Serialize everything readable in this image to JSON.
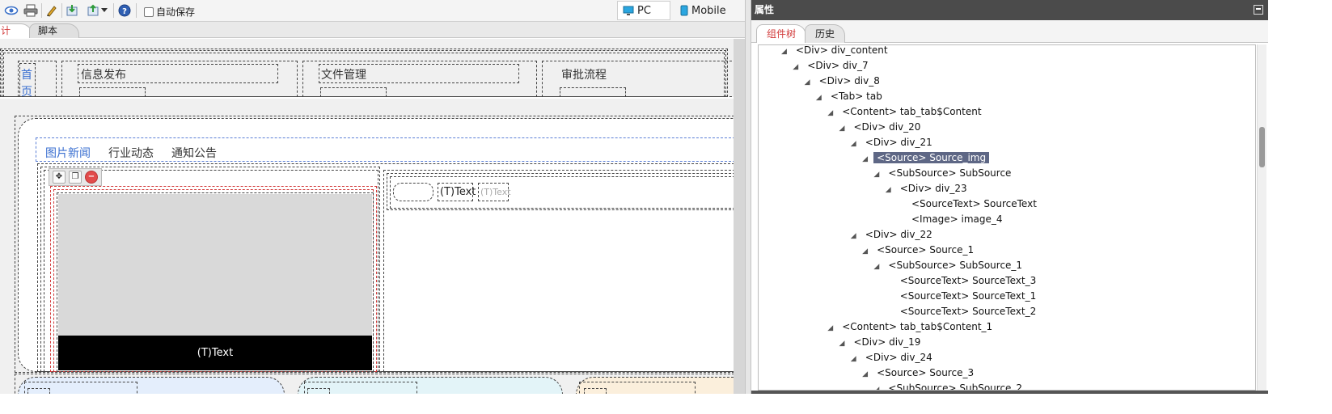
{
  "toolbar": {
    "icons": [
      "eye-icon",
      "print-icon",
      "pen-icon",
      "import-icon",
      "export-icon",
      "help-icon"
    ],
    "autosave_label": "自动保存",
    "device_pc": "PC",
    "device_mobile": "Mobile"
  },
  "left_tabs": {
    "design": "计",
    "script": "脚本"
  },
  "canvas": {
    "nav": {
      "home": "首",
      "home2": "页",
      "info": "信息发布",
      "files": "文件管理",
      "approval": "审批流程"
    },
    "news_tabs": [
      "图片新闻",
      "行业动态",
      "通知公告"
    ],
    "caption": "(T)Text",
    "text1": "(T)Text",
    "text2": "(T)Text"
  },
  "panel": {
    "title": "属性",
    "tabs": [
      "组件树",
      "历史"
    ],
    "tree": [
      {
        "label": "<Div> div_content",
        "level": 0,
        "tri": true
      },
      {
        "label": "<Div> div_7",
        "level": 1,
        "tri": true
      },
      {
        "label": "<Div> div_8",
        "level": 2,
        "tri": true
      },
      {
        "label": "<Tab> tab",
        "level": 3,
        "tri": true
      },
      {
        "label": "<Content> tab_tab$Content",
        "level": 4,
        "tri": true
      },
      {
        "label": "<Div> div_20",
        "level": 5,
        "tri": true
      },
      {
        "label": "<Div> div_21",
        "level": 6,
        "tri": true
      },
      {
        "label": "<Source> Source_img",
        "level": 7,
        "tri": true,
        "selected": true
      },
      {
        "label": "<SubSource> SubSource",
        "level": 8,
        "tri": true
      },
      {
        "label": "<Div> div_23",
        "level": 9,
        "tri": true
      },
      {
        "label": "<SourceText> SourceText",
        "level": 10,
        "tri": false
      },
      {
        "label": "<Image> image_4",
        "level": 10,
        "tri": false
      },
      {
        "label": "<Div> div_22",
        "level": 6,
        "tri": true
      },
      {
        "label": "<Source> Source_1",
        "level": 7,
        "tri": true
      },
      {
        "label": "<SubSource> SubSource_1",
        "level": 8,
        "tri": true
      },
      {
        "label": "<SourceText> SourceText_3",
        "level": 9,
        "tri": false
      },
      {
        "label": "<SourceText> SourceText_1",
        "level": 9,
        "tri": false
      },
      {
        "label": "<SourceText> SourceText_2",
        "level": 9,
        "tri": false
      },
      {
        "label": "<Content> tab_tab$Content_1",
        "level": 4,
        "tri": true
      },
      {
        "label": "<Div> div_19",
        "level": 5,
        "tri": true
      },
      {
        "label": "<Div> div_24",
        "level": 6,
        "tri": true
      },
      {
        "label": "<Source> Source_3",
        "level": 7,
        "tri": true
      },
      {
        "label": "<SubSource> SubSource_2",
        "level": 8,
        "tri": true
      }
    ]
  },
  "colors": {
    "accent_red": "#d23b3b",
    "selection": "#5e6785",
    "link_blue": "#3a6fd0"
  }
}
